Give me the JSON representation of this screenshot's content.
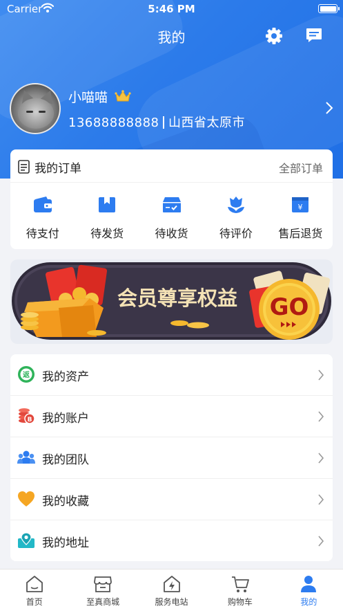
{
  "status": {
    "carrier": "Carrier",
    "time": "5:46 PM"
  },
  "header": {
    "title": "我的",
    "settings_icon": "gear-icon",
    "message_icon": "message-icon"
  },
  "profile": {
    "name": "小喵喵",
    "phone": "13688888888",
    "location": "山西省太原市"
  },
  "orders": {
    "title": "我的订单",
    "all_label": "全部订单",
    "items": [
      {
        "label": "待支付",
        "icon": "wallet-icon"
      },
      {
        "label": "待发货",
        "icon": "package-icon"
      },
      {
        "label": "待收货",
        "icon": "box-check-icon"
      },
      {
        "label": "待评价",
        "icon": "flower-icon"
      },
      {
        "label": "售后退货",
        "icon": "refund-icon"
      }
    ]
  },
  "banner": {
    "text": "会员尊享权益",
    "go": "GO"
  },
  "menu": {
    "items": [
      {
        "label": "我的资产",
        "icon": "rebate-icon"
      },
      {
        "label": "我的账户",
        "icon": "coins-icon"
      },
      {
        "label": "我的团队",
        "icon": "team-icon"
      },
      {
        "label": "我的收藏",
        "icon": "heart-icon"
      },
      {
        "label": "我的地址",
        "icon": "location-icon"
      }
    ]
  },
  "tabbar": {
    "active_index": 4,
    "items": [
      {
        "label": "首页",
        "icon": "home-icon"
      },
      {
        "label": "至真商城",
        "icon": "store-icon"
      },
      {
        "label": "服务电站",
        "icon": "power-station-icon"
      },
      {
        "label": "购物车",
        "icon": "cart-icon"
      },
      {
        "label": "我的",
        "icon": "user-icon"
      }
    ]
  },
  "colors": {
    "primary": "#2D7CF0",
    "hero_start": "#3F8CF0",
    "hero_end": "#1F6FE6",
    "banner_bg": "#3A3448",
    "gold": "#F5B82E"
  }
}
